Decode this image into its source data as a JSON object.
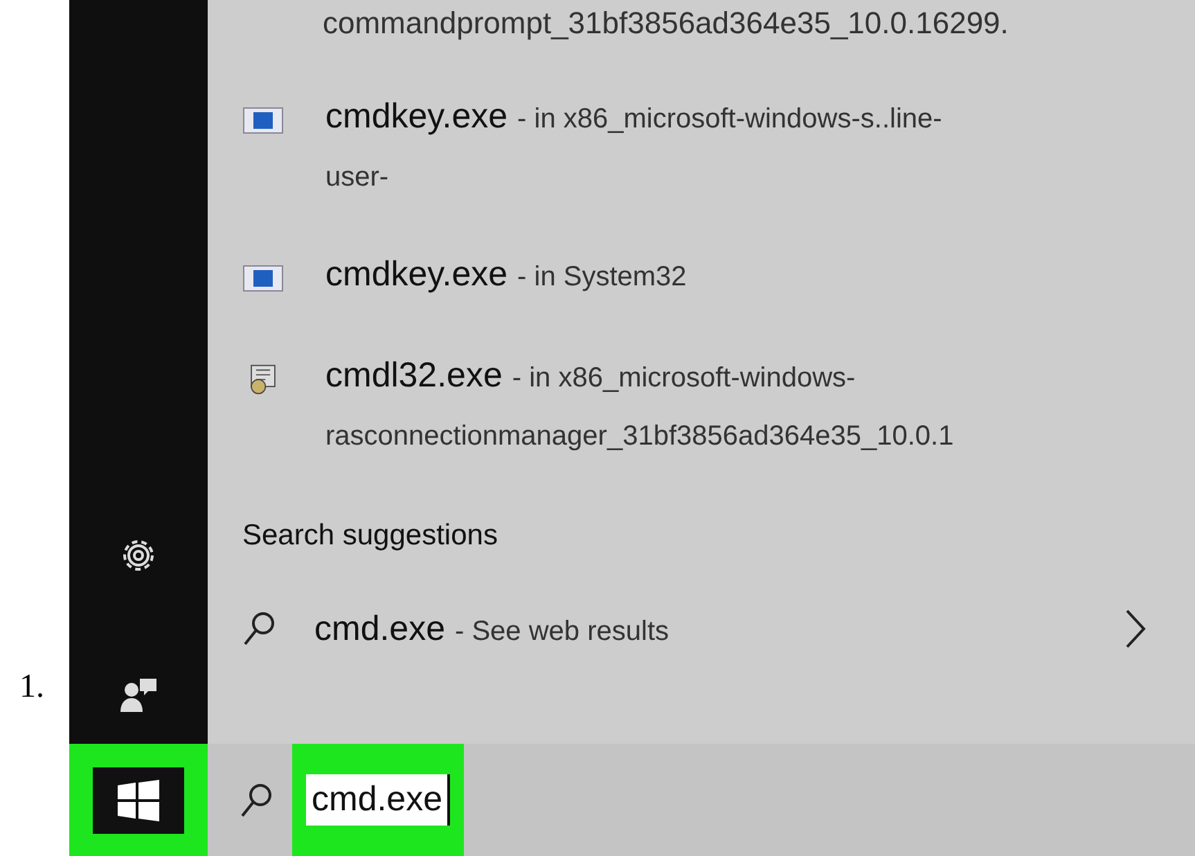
{
  "step_number": "1.",
  "partial_top_line": "commandprompt_31bf3856ad364e35_10.0.16299.",
  "results": [
    {
      "kind": "app",
      "name": "cmdkey.exe",
      "detail": "- in x86_microsoft-windows-s..line-",
      "continuation": "user-"
    },
    {
      "kind": "app",
      "name": "cmdkey.exe",
      "detail": "- in System32"
    },
    {
      "kind": "setup",
      "name": "cmdl32.exe",
      "detail": "- in x86_microsoft-windows-",
      "continuation": "rasconnectionmanager_31bf3856ad364e35_10.0.1"
    }
  ],
  "suggestions_heading": "Search suggestions",
  "suggestions": [
    {
      "query": "cmd.exe",
      "detail": "- See web results"
    }
  ],
  "sidebar_icons": [
    {
      "kind": "settings"
    },
    {
      "kind": "feedback"
    }
  ],
  "start_button": {
    "highlighted": true
  },
  "search_box": {
    "value": "cmd.exe",
    "highlighted": true
  }
}
